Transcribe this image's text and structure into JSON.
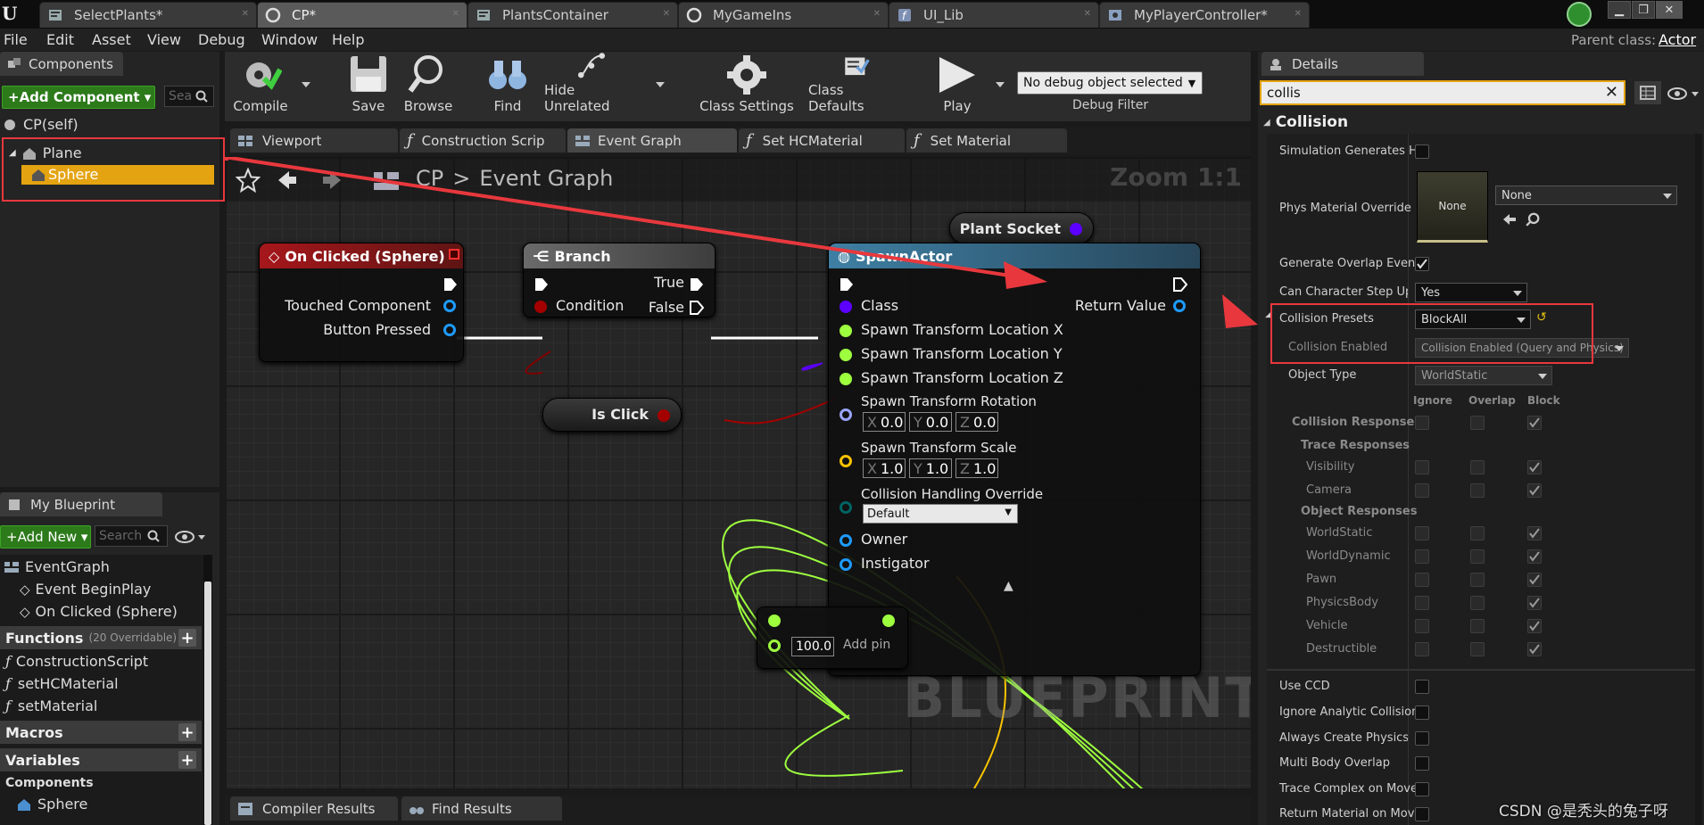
{
  "tabs": [
    {
      "label": "SelectPlants*"
    },
    {
      "label": "CP*"
    },
    {
      "label": "PlantsContainer"
    },
    {
      "label": "MyGameIns"
    },
    {
      "label": "UI_Lib"
    },
    {
      "label": "MyPlayerController*"
    }
  ],
  "menu": [
    "File",
    "Edit",
    "Asset",
    "View",
    "Debug",
    "Window",
    "Help"
  ],
  "parent_class": {
    "label": "Parent class:",
    "value": "Actor"
  },
  "components_panel": {
    "title": "Components",
    "add_button": "+Add Component ▾",
    "search_placeholder": "Sea",
    "self_item": "CP(self)",
    "tree": [
      "Plane",
      "Sphere"
    ]
  },
  "toolbar": {
    "compile": "Compile",
    "save": "Save",
    "browse": "Browse",
    "find": "Find",
    "hide_unrelated": "Hide Unrelated",
    "class_settings": "Class Settings",
    "class_defaults": "Class Defaults",
    "play": "Play",
    "debug_object": "No debug object selected",
    "debug_filter": "Debug Filter"
  },
  "editor_tabs": [
    "Viewport",
    "Construction Scrip",
    "Event Graph",
    "Set HCMaterial",
    "Set Material"
  ],
  "breadcrumb": {
    "root": "CP",
    "sep": ">",
    "current": "Event Graph",
    "zoom": "Zoom 1:1"
  },
  "nodes": {
    "on_clicked": {
      "title": "On Clicked (Sphere)",
      "pins": [
        "Touched Component",
        "Button Pressed"
      ]
    },
    "branch": {
      "title": "Branch",
      "condition": "Condition",
      "true": "True",
      "false": "False"
    },
    "is_click": {
      "label": "Is Click"
    },
    "plant_socket": {
      "label": "Plant Socket"
    },
    "spawn_actor": {
      "title": "SpawnActor",
      "class": "Class",
      "return_value": "Return Value",
      "loc_x": "Spawn Transform Location X",
      "loc_y": "Spawn Transform Location Y",
      "loc_z": "Spawn Transform Location Z",
      "rotation": "Spawn Transform Rotation",
      "rot": {
        "x": "0.0",
        "y": "0.0",
        "z": "0.0"
      },
      "scale": "Spawn Transform Scale",
      "scl": {
        "x": "1.0",
        "y": "1.0",
        "z": "1.0"
      },
      "collision_override": "Collision Handling Override",
      "collision_value": "Default",
      "owner": "Owner",
      "instigator": "Instigator"
    },
    "add_node": {
      "value": "100.0",
      "add_pin": "Add pin"
    }
  },
  "watermark": "BLUEPRINT",
  "axis_labels": {
    "x": "X",
    "y": "Y",
    "z": "Z"
  },
  "bottom_tabs": [
    "Compiler Results",
    "Find Results"
  ],
  "my_blueprint": {
    "title": "My Blueprint",
    "add_new": "+Add New ▾",
    "search_placeholder": "Search",
    "event_graph": "EventGraph",
    "events": [
      "Event BeginPlay",
      "On Clicked (Sphere)"
    ],
    "functions_label": "Functions",
    "functions_note": "(20 Overridable)",
    "functions": [
      "ConstructionScript",
      "setHCMaterial",
      "setMaterial"
    ],
    "macros_label": "Macros",
    "variables_label": "Variables",
    "components_label": "Components",
    "components": [
      "Sphere"
    ]
  },
  "details": {
    "title": "Details",
    "search_value": "collis",
    "section": "Collision",
    "simulation_generates_hit": "Simulation Generates Hit",
    "phys_material_override": "Phys Material Override",
    "phys_thumb": "None",
    "phys_value": "None",
    "generate_overlap_events": "Generate Overlap Events",
    "can_character_step_up": "Can Character Step Up Or",
    "can_character_step_up_value": "Yes",
    "collision_presets": "Collision Presets",
    "collision_presets_value": "BlockAll",
    "collision_enabled": "Collision Enabled",
    "collision_enabled_value": "Collision Enabled (Query and Physics)",
    "object_type": "Object Type",
    "object_type_value": "WorldStatic",
    "response_cols": [
      "Ignore",
      "Overlap",
      "Block"
    ],
    "collision_responses": "Collision Responses",
    "trace_responses": "Trace Responses",
    "trace_items": [
      "Visibility",
      "Camera"
    ],
    "object_responses": "Object Responses",
    "object_items": [
      "WorldStatic",
      "WorldDynamic",
      "Pawn",
      "PhysicsBody",
      "Vehicle",
      "Destructible"
    ],
    "bottom_options": [
      "Use CCD",
      "Ignore Analytic Collisions",
      "Always Create Physics St",
      "Multi Body Overlap",
      "Trace Complex on Move",
      "Return Material on Move"
    ]
  },
  "credit": "CSDN @是秃头的兔子呀",
  "colors": {
    "exec": "#ffffff",
    "object_pin": "#1e9bff",
    "bool_pin": "#a40000",
    "float_pin": "#9eff3f",
    "rotator_pin": "#99a4ff",
    "vector_pin": "#f9c300",
    "byte_pin": "#006363",
    "class_pin": "#5c00ff",
    "annotation": "#e8383d"
  }
}
